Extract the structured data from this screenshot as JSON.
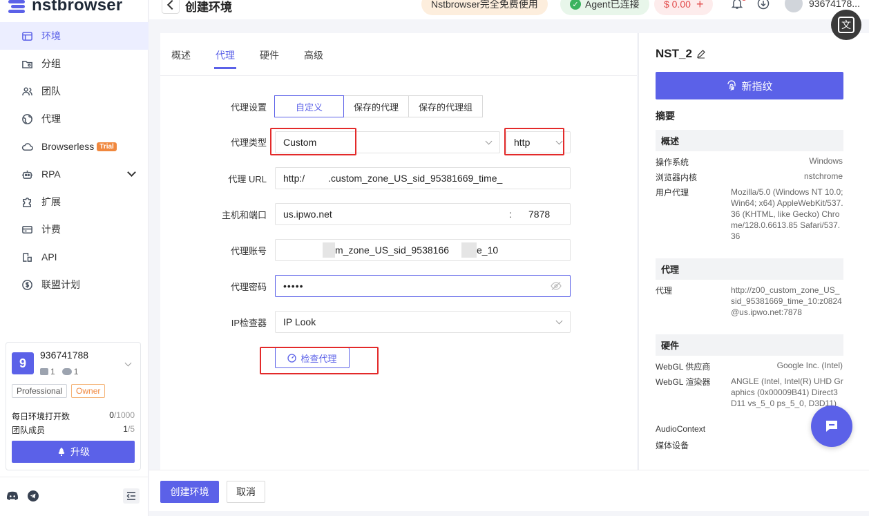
{
  "app": {
    "logo_text": "nstbrowser",
    "accent_color": "#5b61e8"
  },
  "sidebar": {
    "items": [
      {
        "label": "环境",
        "icon": "browser-window-icon"
      },
      {
        "label": "分组",
        "icon": "folder-icon"
      },
      {
        "label": "团队",
        "icon": "team-icon"
      },
      {
        "label": "代理",
        "icon": "globe-icon"
      },
      {
        "label": "Browserless",
        "icon": "cloud-icon",
        "badge": "Trial"
      },
      {
        "label": "RPA",
        "icon": "robot-icon"
      },
      {
        "label": "扩展",
        "icon": "puzzle-icon"
      },
      {
        "label": "计费",
        "icon": "card-icon"
      },
      {
        "label": "API",
        "icon": "api-icon"
      },
      {
        "label": "联盟计划",
        "icon": "dollar-icon"
      }
    ],
    "user": {
      "avatar_letter": "9",
      "id": "936741788",
      "devices": "1",
      "members": "1",
      "plan_tag": "Professional",
      "role_tag": "Owner",
      "daily_label": "每日环境打开数",
      "daily_used": "0",
      "daily_total": "/1000",
      "team_label": "团队成员",
      "team_used": "1",
      "team_total": "/5",
      "upgrade_label": "升级"
    }
  },
  "topbar": {
    "title": "创建环境",
    "free_pill": "Nstbrowser完全免费使用",
    "agent_pill": "Agent已连接",
    "balance": "$ 0.00",
    "balance_plus": "+",
    "username": "93674178..."
  },
  "tabs": [
    "概述",
    "代理",
    "硬件",
    "高级"
  ],
  "form": {
    "proxy_setting_label": "代理设置",
    "proxy_setting_options": [
      "自定义",
      "保存的代理",
      "保存的代理组"
    ],
    "proxy_type_label": "代理类型",
    "proxy_type_value": "Custom",
    "protocol_value": "http",
    "proxy_url_label": "代理 URL",
    "proxy_url_prefix": "http:/",
    "proxy_url_value": ".custom_zone_US_sid_95381669_time_",
    "host_port_label": "主机和端口",
    "host_value": "us.ipwo.net",
    "port_sep": ":",
    "port_value": "7878",
    "account_label": "代理账号",
    "account_part1": "m_zone_US_sid_9538166",
    "account_part2": "e_10",
    "password_label": "代理密码",
    "password_value": "•••••",
    "checker_label": "IP检查器",
    "checker_value": "IP Look",
    "check_button": "检查代理"
  },
  "summary": {
    "env_name": "NST_2",
    "new_fingerprint": "新指纹",
    "title": "摘要",
    "overview_head": "概述",
    "os_label": "操作系统",
    "os_value": "Windows",
    "kernel_label": "浏览器内核",
    "kernel_value": "nstchrome",
    "ua_label": "用户代理",
    "ua_value": "Mozilla/5.0 (Windows NT 10.0; Win64; x64) AppleWebKit/537.36 (KHTML, like Gecko) Chrome/128.0.6613.85 Safari/537.36",
    "proxy_head": "代理",
    "proxy_label": "代理",
    "proxy_value": "http://z00_custom_zone_US_sid_95381669_time_10:z0824@us.ipwo.net:7878",
    "hw_head": "硬件",
    "webgl_vendor_label": "WebGL 供应商",
    "webgl_vendor_value": "Google Inc. (Intel)",
    "webgl_renderer_label": "WebGL 渲染器",
    "webgl_renderer_value": "ANGLE (Intel, Intel(R) UHD Graphics (0x00009B41) Direct3D11 vs_5_0 ps_5_0, D3D11)",
    "audio_label": "AudioContext",
    "media_label": "媒体设备"
  },
  "bottom": {
    "create": "创建环境",
    "cancel": "取消"
  },
  "floating": {
    "translate_glyph": "文"
  }
}
